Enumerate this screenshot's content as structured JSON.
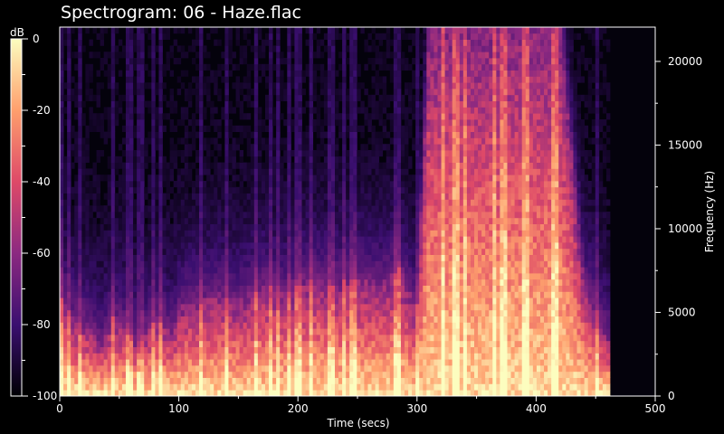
{
  "title": "Spectrogram: 06 - Haze.flac",
  "chart_data": {
    "type": "heatmap",
    "title": "Spectrogram: 06 - Haze.flac",
    "xlabel": "Time (secs)",
    "ylabel": "Frequency (Hz)",
    "colorbar_label": "dB",
    "xlim": [
      0,
      500
    ],
    "ylim": [
      0,
      22050
    ],
    "x_ticks": [
      0,
      100,
      200,
      300,
      400,
      500
    ],
    "y_ticks": [
      0,
      5000,
      10000,
      15000,
      20000
    ],
    "db_range": [
      -100,
      0
    ],
    "db_ticks": [
      0,
      -20,
      -40,
      -60,
      -80,
      -100
    ],
    "track_duration_secs": 462,
    "colormap": [
      "#000004",
      "#3b0f70",
      "#8c2981",
      "#de4968",
      "#fe9f6d",
      "#fcfdbf"
    ],
    "energy_profile": {
      "time_secs": [
        0,
        10,
        25,
        35,
        45,
        55,
        65,
        75,
        85,
        95,
        100,
        110,
        120,
        130,
        150,
        170,
        190,
        210,
        230,
        250,
        270,
        285,
        300,
        310,
        350,
        400,
        420,
        440,
        450,
        462
      ],
      "dominant_high_freq_hz": [
        6000,
        4500,
        4000,
        3000,
        4500,
        4000,
        3000,
        4000,
        4500,
        3500,
        5000,
        5500,
        5500,
        6000,
        5500,
        6500,
        6000,
        7000,
        6500,
        7000,
        6500,
        7500,
        5000,
        22050,
        22050,
        22050,
        22050,
        6500,
        5000,
        3000
      ]
    }
  }
}
